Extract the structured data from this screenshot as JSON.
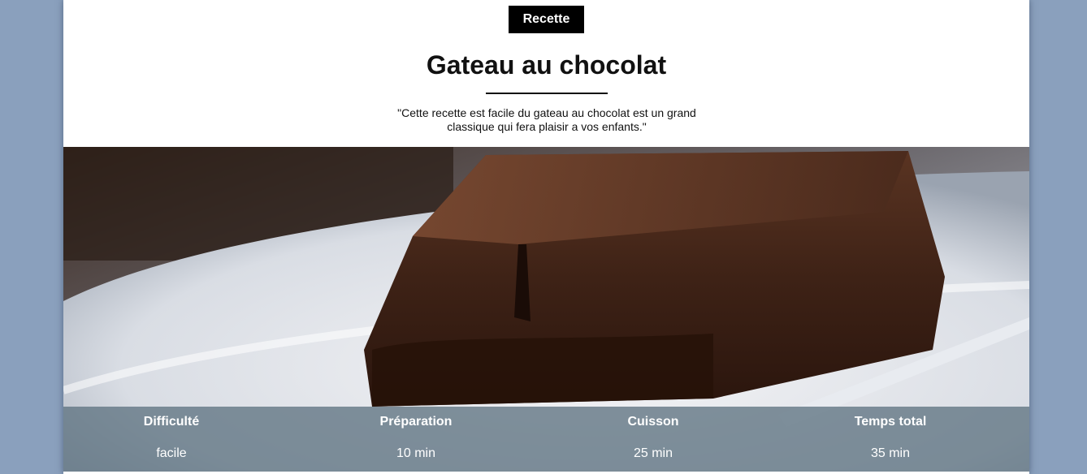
{
  "header": {
    "badge": "Recette",
    "title": "Gateau au chocolat",
    "quote": "\"Cette recette est facile du gateau au chocolat est un grand classique qui fera plaisir a vos enfants.\""
  },
  "image": {
    "icon": "chocolate-cake-photo"
  },
  "stats": [
    {
      "label": "Difficulté",
      "value": "facile"
    },
    {
      "label": "Préparation",
      "value": "10 min"
    },
    {
      "label": "Cuisson",
      "value": "25 min"
    },
    {
      "label": "Temps total",
      "value": "35 min"
    }
  ],
  "colors": {
    "page_background": "#8aa0bd",
    "card": "#ffffff",
    "badge": "#000000",
    "stats_overlay": "#5f7382"
  }
}
